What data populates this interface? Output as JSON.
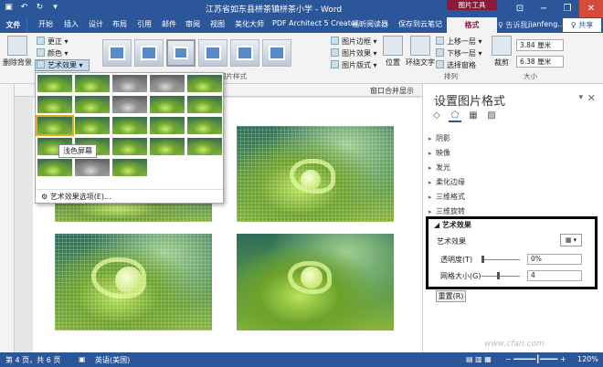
{
  "titlebar": {
    "qat": [
      "save-icon",
      "undo-icon",
      "redo-icon",
      "customize-icon"
    ],
    "title": "江苏省如东县栟茶镇栟茶小学 - Word",
    "contextual_tab_group": "图片工具",
    "window_buttons": [
      "ribbon-display-icon",
      "minimize-icon",
      "restore-icon",
      "close-icon"
    ]
  },
  "tabs": {
    "file": "文件",
    "items": [
      "开始",
      "插入",
      "设计",
      "布局",
      "引用",
      "邮件",
      "审阅",
      "视图",
      "美化大师",
      "PDF Architect 5 Creator",
      "福昕阅读器",
      "保存到云笔记"
    ],
    "format": "格式",
    "tell_me": "♀ 告诉我...",
    "user": "jianfeng...",
    "share": "♀ 共享"
  },
  "ribbon": {
    "remove_bg": "删除背景",
    "corrections": "更正 ▾",
    "color": "颜色 ▾",
    "art_effects": "艺术效果 ▾",
    "styles_group": "图片样式",
    "picture_border": "图片边框 ▾",
    "picture_effects": "图片效果 ▾",
    "picture_layout": "图片版式 ▾",
    "position": "位置",
    "wrap_text": "环绕文字",
    "bring_forward": "上移一层 ▾",
    "send_backward": "下移一层 ▾",
    "selection_pane": "选择窗格",
    "arrange_group": "排列",
    "crop": "裁剪",
    "height": "3.84 厘米",
    "width": "6.38 厘米",
    "size_group": "大小",
    "text_wrap_badge": "窗口合并显示"
  },
  "gallery": {
    "tooltip": "浅色屏幕",
    "options": "艺术效果选项(E)...",
    "options_icon": "gear-icon"
  },
  "pane": {
    "title": "设置图片格式",
    "sections": [
      "阴影",
      "映像",
      "发光",
      "柔化边缘",
      "三维格式",
      "三维旋转"
    ],
    "art_effects_section": "艺术效果",
    "art_effects_label": "艺术效果",
    "transparency_label": "透明度(T)",
    "transparency_value": "0%",
    "grid_size_label": "网格大小(G)",
    "grid_size_value": "4",
    "reset": "重置(R)"
  },
  "statusbar": {
    "page": "第 4 页，共 6 页",
    "language": "英语(美国)",
    "zoom": "120%"
  },
  "watermark": "www.cfan.com"
}
